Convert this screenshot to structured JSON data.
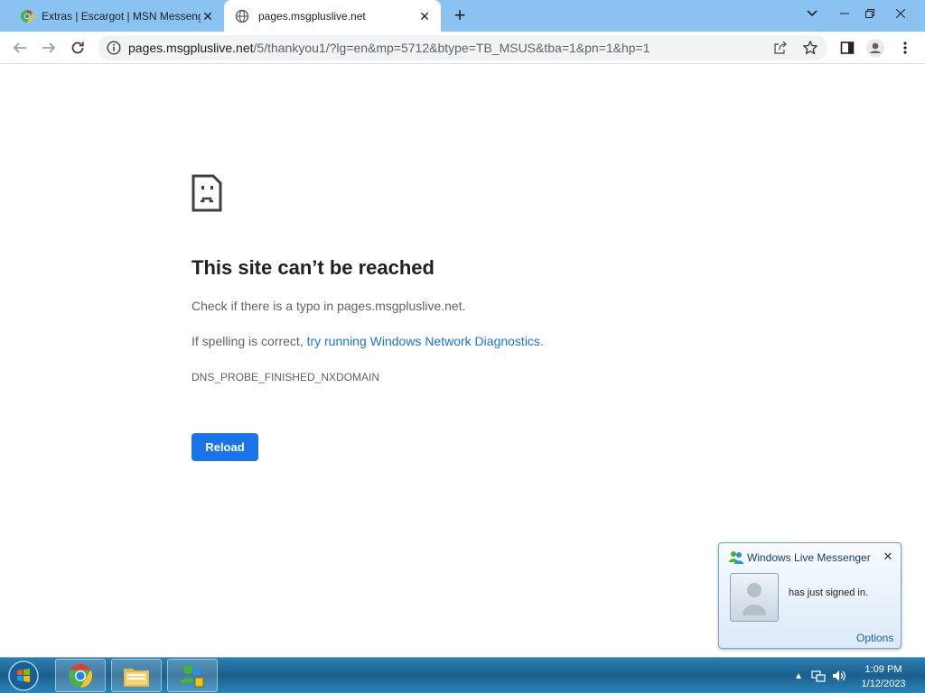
{
  "browser": {
    "tabs": [
      {
        "title": "Extras | Escargot | MSN Messeng",
        "icon": "chrome-favicon-icon"
      },
      {
        "title": "pages.msgpluslive.net",
        "icon": "globe-icon",
        "active": true
      }
    ],
    "address_host": "pages.msgpluslive.net",
    "address_path": "/5/thankyou1/?lg=en&mp=5712&btype=TB_MSUS&tba=1&pn=1&hp=1"
  },
  "error_page": {
    "title": "This site can’t be reached",
    "check_text": "Check if there is a typo in pages.msgpluslive.net.",
    "spelling_prefix": "If spelling is correct, ",
    "diagnostics_link": "try running Windows Network Diagnostics",
    "spelling_suffix": ".",
    "error_code": "DNS_PROBE_FINISHED_NXDOMAIN",
    "reload_label": "Reload",
    "accent_color": "#1a73e8"
  },
  "messenger_toast": {
    "app_title": "Windows Live Messenger",
    "contact_name": "",
    "message_line2": "has just signed in.",
    "options_label": "Options"
  },
  "taskbar": {
    "pinned": [
      "chrome-icon",
      "file-explorer-icon",
      "windows-live-messenger-icon"
    ],
    "clock_time": "1:09 PM",
    "clock_date": "1/12/2023"
  }
}
